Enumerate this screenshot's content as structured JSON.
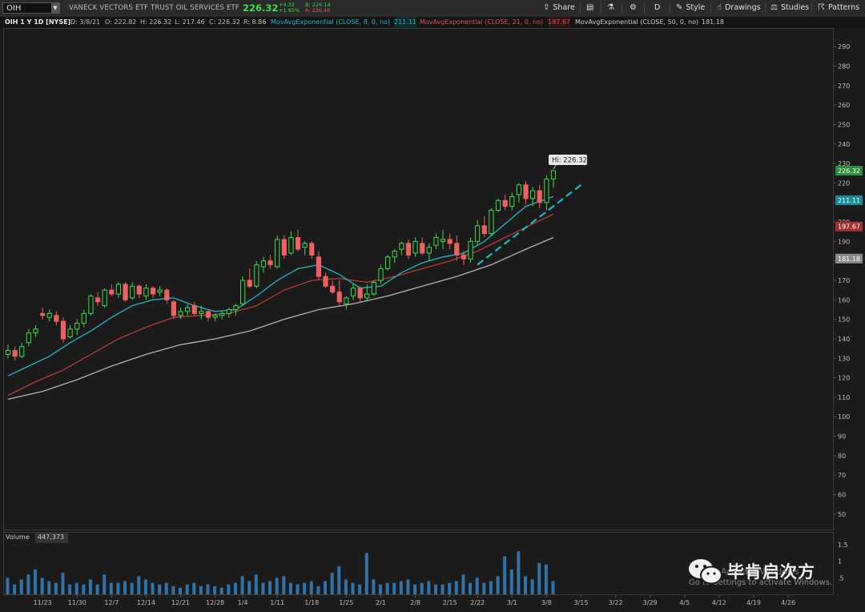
{
  "toolbar": {
    "symbol": "OIH",
    "description": "VANECK VECTORS ETF TRUST OIL SERVICES ETF",
    "last_price": "226.32",
    "change": "+4.32",
    "change_pct": "+1.95%",
    "bid": "B: 226.14",
    "ask": "A: 226.40",
    "buttons": {
      "share": "Share",
      "aggregation": "D",
      "style": "Style",
      "drawings": "Drawings",
      "studies": "Studies",
      "patterns": "Patterns"
    }
  },
  "study_bar": {
    "chart_label": "OIH 1 Y 1D [NYSE]",
    "date": "D: 3/8/21",
    "open": "O: 222.82",
    "high": "H: 226.32",
    "low": "L: 217.46",
    "close": "C: 226.32",
    "range": "R: 8.86",
    "ema8_label": "MovAvgExponential (CLOSE, 8, 0, no)",
    "ema8_value": "211.11",
    "ema21_label": "MovAvgExponential (CLOSE, 21, 0, no)",
    "ema21_value": "197.67",
    "ema50_label": "MovAvgExponential (CLOSE, 50, 0, no)",
    "ema50_value": "181.18"
  },
  "colors": {
    "up": "#3ddc4a",
    "down": "#ef6161",
    "ema8": "#20b8c8",
    "ema21": "#b83a3a",
    "ema50": "#b4b4b4",
    "volume": "#2f73a8",
    "trendline": "#20b8c8"
  },
  "volume_panel": {
    "label": "Volume",
    "value": "447,373"
  },
  "watermark": {
    "text": "毕肯启次方",
    "windows_line1": "Activate Windows",
    "windows_line2": "Go to Settings to activate Windows."
  },
  "chart_data": {
    "type": "candlestick",
    "ylim": [
      45,
      295
    ],
    "yticks": [
      50,
      60,
      70,
      80,
      90,
      100,
      110,
      120,
      130,
      140,
      150,
      160,
      170,
      180,
      190,
      200,
      210,
      220,
      230,
      240,
      250,
      260,
      270,
      280,
      290
    ],
    "x_labels": [
      {
        "label": "11/23",
        "i": 5
      },
      {
        "label": "11/30",
        "i": 10
      },
      {
        "label": "12/7",
        "i": 15
      },
      {
        "label": "12/14",
        "i": 20
      },
      {
        "label": "12/21",
        "i": 25
      },
      {
        "label": "12/28",
        "i": 30
      },
      {
        "label": "1/4",
        "i": 34
      },
      {
        "label": "1/11",
        "i": 39
      },
      {
        "label": "1/18",
        "i": 44
      },
      {
        "label": "1/25",
        "i": 49
      },
      {
        "label": "2/1",
        "i": 54
      },
      {
        "label": "2/8",
        "i": 59
      },
      {
        "label": "2/15",
        "i": 64
      },
      {
        "label": "2/22",
        "i": 68
      },
      {
        "label": "3/1",
        "i": 73
      },
      {
        "label": "3/8",
        "i": 78
      },
      {
        "label": "3/15",
        "i": 83
      },
      {
        "label": "3/22",
        "i": 88
      },
      {
        "label": "3/29",
        "i": 93
      },
      {
        "label": "4/5",
        "i": 98
      },
      {
        "label": "4/12",
        "i": 103
      },
      {
        "label": "4/19",
        "i": 108
      },
      {
        "label": "4/26",
        "i": 113
      }
    ],
    "candles": [
      [
        132,
        137,
        130,
        134
      ],
      [
        134,
        136,
        129,
        131
      ],
      [
        131,
        138,
        130,
        136
      ],
      [
        138,
        145,
        136,
        143
      ],
      [
        143,
        147,
        141,
        145
      ],
      [
        153,
        156,
        150,
        152
      ],
      [
        151,
        155,
        149,
        153
      ],
      [
        152,
        154,
        147,
        149
      ],
      [
        149,
        151,
        138,
        140
      ],
      [
        141,
        147,
        140,
        145
      ],
      [
        145,
        150,
        142,
        148
      ],
      [
        148,
        155,
        146,
        153
      ],
      [
        153,
        163,
        152,
        162
      ],
      [
        161,
        164,
        157,
        159
      ],
      [
        157,
        166,
        156,
        165
      ],
      [
        165,
        168,
        162,
        163
      ],
      [
        163,
        169,
        161,
        168
      ],
      [
        168,
        169,
        159,
        160
      ],
      [
        161,
        169,
        160,
        167
      ],
      [
        167,
        168,
        161,
        163
      ],
      [
        162,
        168,
        160,
        166
      ],
      [
        166,
        167,
        161,
        163
      ],
      [
        164,
        167,
        162,
        165
      ],
      [
        165,
        166,
        158,
        160
      ],
      [
        159,
        160,
        150,
        152
      ],
      [
        152,
        156,
        150,
        154
      ],
      [
        154,
        158,
        152,
        156
      ],
      [
        157,
        159,
        152,
        153
      ],
      [
        153,
        157,
        150,
        154
      ],
      [
        154,
        155,
        149,
        151
      ],
      [
        151,
        153,
        149,
        152
      ],
      [
        152,
        154,
        150,
        153
      ],
      [
        153,
        156,
        151,
        155
      ],
      [
        155,
        158,
        152,
        157
      ],
      [
        158,
        172,
        157,
        170
      ],
      [
        170,
        176,
        166,
        167
      ],
      [
        167,
        180,
        166,
        178
      ],
      [
        177,
        182,
        174,
        180
      ],
      [
        180,
        183,
        176,
        178
      ],
      [
        177,
        193,
        176,
        191
      ],
      [
        191,
        193,
        181,
        183
      ],
      [
        184,
        195,
        183,
        192
      ],
      [
        192,
        196,
        185,
        186
      ],
      [
        187,
        190,
        183,
        189
      ],
      [
        189,
        190,
        181,
        183
      ],
      [
        182,
        185,
        170,
        172
      ],
      [
        172,
        174,
        166,
        167
      ],
      [
        167,
        170,
        163,
        164
      ],
      [
        164,
        170,
        157,
        159
      ],
      [
        158,
        162,
        155,
        161
      ],
      [
        162,
        168,
        160,
        166
      ],
      [
        166,
        167,
        159,
        161
      ],
      [
        161,
        168,
        159,
        163
      ],
      [
        163,
        170,
        162,
        169
      ],
      [
        170,
        178,
        168,
        176
      ],
      [
        176,
        183,
        175,
        182
      ],
      [
        182,
        186,
        179,
        185
      ],
      [
        186,
        190,
        183,
        189
      ],
      [
        189,
        191,
        181,
        183
      ],
      [
        184,
        192,
        182,
        190
      ],
      [
        189,
        192,
        183,
        184
      ],
      [
        184,
        189,
        180,
        187
      ],
      [
        188,
        194,
        186,
        192
      ],
      [
        190,
        196,
        186,
        191
      ],
      [
        191,
        194,
        186,
        189
      ],
      [
        189,
        193,
        180,
        183
      ],
      [
        183,
        185,
        178,
        181
      ],
      [
        181,
        192,
        179,
        190
      ],
      [
        190,
        201,
        188,
        198
      ],
      [
        198,
        203,
        192,
        194
      ],
      [
        194,
        207,
        193,
        206
      ],
      [
        206,
        212,
        205,
        211
      ],
      [
        211,
        214,
        206,
        208
      ],
      [
        208,
        215,
        206,
        213
      ],
      [
        214,
        220,
        210,
        219
      ],
      [
        219,
        221,
        209,
        212
      ],
      [
        212,
        218,
        208,
        216
      ],
      [
        216,
        219,
        207,
        210
      ],
      [
        210,
        224,
        206,
        222
      ],
      [
        222,
        226.32,
        217.46,
        226.32
      ]
    ],
    "ema8": [
      [
        0,
        121
      ],
      [
        3,
        126
      ],
      [
        6,
        131
      ],
      [
        9,
        138
      ],
      [
        12,
        144
      ],
      [
        15,
        151
      ],
      [
        18,
        157
      ],
      [
        21,
        160
      ],
      [
        24,
        161
      ],
      [
        27,
        157
      ],
      [
        30,
        154
      ],
      [
        33,
        155
      ],
      [
        36,
        162
      ],
      [
        39,
        170
      ],
      [
        42,
        176
      ],
      [
        45,
        178
      ],
      [
        48,
        173
      ],
      [
        51,
        166
      ],
      [
        54,
        167
      ],
      [
        57,
        174
      ],
      [
        60,
        179
      ],
      [
        63,
        182
      ],
      [
        66,
        184
      ],
      [
        69,
        190
      ],
      [
        72,
        199
      ],
      [
        75,
        208
      ],
      [
        79,
        213
      ]
    ],
    "ema21": [
      [
        0,
        111
      ],
      [
        4,
        118
      ],
      [
        8,
        124
      ],
      [
        12,
        132
      ],
      [
        16,
        140
      ],
      [
        20,
        146
      ],
      [
        24,
        151
      ],
      [
        28,
        152
      ],
      [
        32,
        153
      ],
      [
        36,
        157
      ],
      [
        40,
        165
      ],
      [
        44,
        170
      ],
      [
        48,
        171
      ],
      [
        52,
        169
      ],
      [
        56,
        172
      ],
      [
        60,
        176
      ],
      [
        64,
        180
      ],
      [
        68,
        185
      ],
      [
        72,
        192
      ],
      [
        76,
        199
      ],
      [
        79,
        204
      ]
    ],
    "ema50": [
      [
        0,
        109
      ],
      [
        5,
        113
      ],
      [
        10,
        119
      ],
      [
        15,
        126
      ],
      [
        20,
        132
      ],
      [
        25,
        137
      ],
      [
        30,
        140
      ],
      [
        35,
        144
      ],
      [
        40,
        150
      ],
      [
        45,
        155
      ],
      [
        50,
        158
      ],
      [
        55,
        162
      ],
      [
        60,
        167
      ],
      [
        65,
        172
      ],
      [
        70,
        178
      ],
      [
        75,
        186
      ],
      [
        79,
        192
      ]
    ],
    "trendline": [
      [
        68,
        178
      ],
      [
        83,
        219
      ]
    ],
    "hi_label": "Hi: 226.32",
    "price_badges": [
      {
        "value": "226.32",
        "color": "#2d8f3e"
      },
      {
        "value": "211.11",
        "color": "#1b8a99"
      },
      {
        "value": "197.67",
        "color": "#a63030"
      },
      {
        "value": "181.18",
        "color": "#8a8a8a"
      }
    ],
    "volume": [
      0.5,
      0.3,
      0.45,
      0.6,
      0.75,
      0.5,
      0.4,
      0.35,
      0.65,
      0.3,
      0.35,
      0.3,
      0.45,
      0.3,
      0.6,
      0.35,
      0.35,
      0.4,
      0.35,
      0.55,
      0.45,
      0.35,
      0.3,
      0.35,
      0.25,
      0.2,
      0.3,
      0.35,
      0.25,
      0.3,
      0.25,
      0.2,
      0.3,
      0.35,
      0.55,
      0.4,
      0.6,
      0.35,
      0.4,
      0.5,
      0.55,
      0.35,
      0.3,
      0.35,
      0.4,
      0.25,
      0.4,
      0.65,
      0.85,
      0.45,
      0.35,
      0.3,
      1.25,
      0.45,
      0.3,
      0.35,
      0.35,
      0.4,
      0.45,
      0.3,
      0.35,
      0.4,
      0.3,
      0.3,
      0.35,
      0.4,
      0.6,
      0.35,
      0.5,
      0.35,
      0.4,
      0.55,
      1.15,
      0.75,
      1.3,
      0.55,
      0.45,
      0.95,
      0.9,
      0.4
    ],
    "volume_ylim": [
      0,
      1.5
    ],
    "volume_ticks": [
      {
        "v": 1.5,
        "label": "1.5"
      },
      {
        "v": 1,
        "label": "1"
      },
      {
        "v": 0.5,
        "label": ".5"
      }
    ]
  }
}
